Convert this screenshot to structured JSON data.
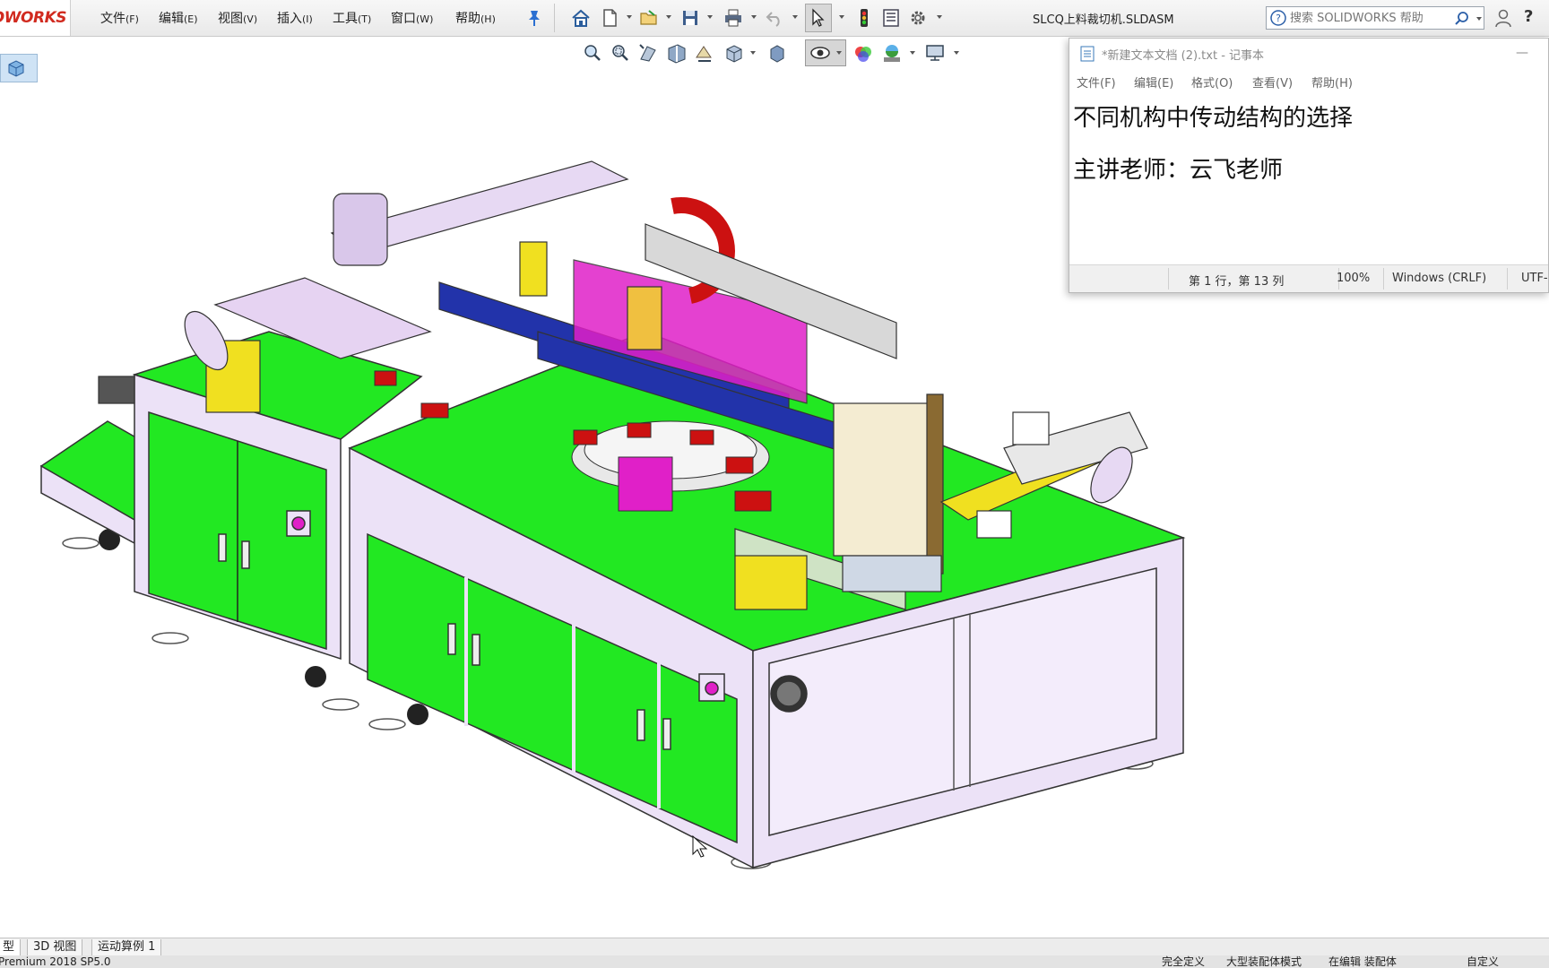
{
  "app": {
    "logo_text": "DWORKS",
    "document_title": "SLCQ上料裁切机.SLDASM"
  },
  "menu": [
    {
      "label": "文件",
      "accel": "(F)"
    },
    {
      "label": "编辑",
      "accel": "(E)"
    },
    {
      "label": "视图",
      "accel": "(V)"
    },
    {
      "label": "插入",
      "accel": "(I)"
    },
    {
      "label": "工具",
      "accel": "(T)"
    },
    {
      "label": "窗口",
      "accel": "(W)"
    },
    {
      "label": "帮助",
      "accel": "(H)"
    }
  ],
  "toolbar_icons": [
    "pin-icon",
    "home-icon",
    "new-document-icon",
    "open-folder-icon",
    "save-icon",
    "print-icon",
    "undo-icon",
    "select-arrow-icon",
    "traffic-light-icon",
    "file-properties-icon",
    "options-gear-icon"
  ],
  "search": {
    "placeholder": "搜索 SOLIDWORKS 帮助"
  },
  "view_toolbar_icons": [
    "zoom-to-fit-icon",
    "zoom-to-area-icon",
    "previous-view-icon",
    "section-view-icon",
    "dynamic-annotation-icon",
    "view-orientation-icon",
    "display-style-icon",
    "hide-show-items-icon",
    "edit-appearance-icon",
    "apply-scene-icon",
    "view-settings-icon"
  ],
  "notepad": {
    "title": "*新建文本文档 (2).txt - 记事本",
    "menu": [
      "文件(F)",
      "编辑(E)",
      "格式(O)",
      "查看(V)",
      "帮助(H)"
    ],
    "lines": [
      "不同机构中传动结构的选择",
      "",
      "主讲老师：云飞老师"
    ],
    "status": {
      "position": "第 1 行，第 13 列",
      "zoom": "100%",
      "line_ending": "Windows (CRLF)",
      "encoding": "UTF-"
    }
  },
  "tabs": [
    {
      "label": "型",
      "active": true
    },
    {
      "label": "3D 视图",
      "active": false
    },
    {
      "label": "运动算例 1",
      "active": false
    }
  ],
  "status_bar": {
    "version": "Premium 2018 SP5.0",
    "items": [
      "完全定义",
      "大型装配体模式",
      "在编辑 装配体",
      "自定义"
    ]
  },
  "colors": {
    "accent_green": "#22e822",
    "frame_lavender": "#ece2f7",
    "rail_blue": "#2233aa",
    "magenta": "#e020c8",
    "cable_red": "#cc1111",
    "yellow": "#f0e020"
  }
}
